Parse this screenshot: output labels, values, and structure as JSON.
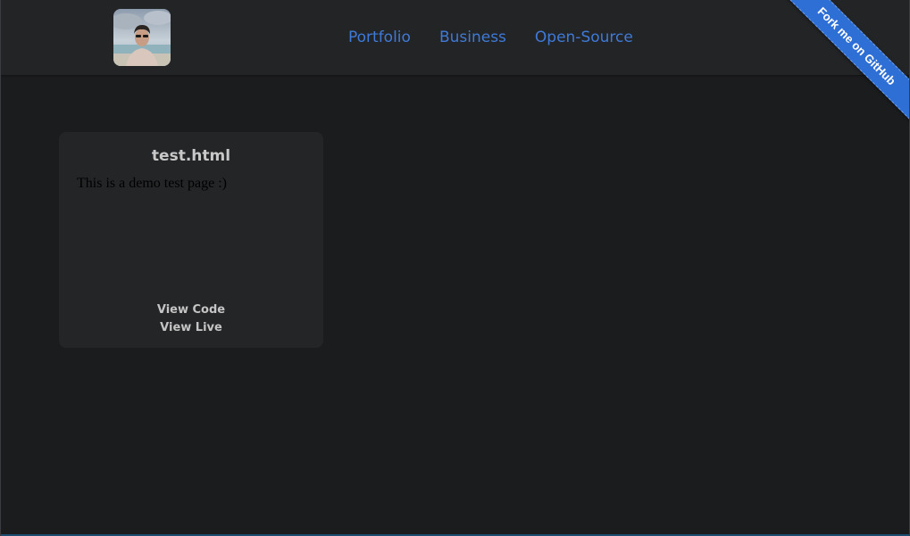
{
  "header": {
    "avatar_alt": "profile photo",
    "nav": [
      {
        "label": "Portfolio"
      },
      {
        "label": "Business"
      },
      {
        "label": "Open-Source"
      }
    ],
    "ribbon_label": "Fork me on GitHub"
  },
  "card": {
    "title": "test.html",
    "preview_text": "This is a demo test page :)",
    "view_code_label": "View Code",
    "view_live_label": "View Live"
  },
  "colors": {
    "background": "#1b1c1e",
    "header_bg": "#232426",
    "card_bg": "#242527",
    "nav_link": "#3f7ad8",
    "ribbon": "#2e6fd6"
  }
}
